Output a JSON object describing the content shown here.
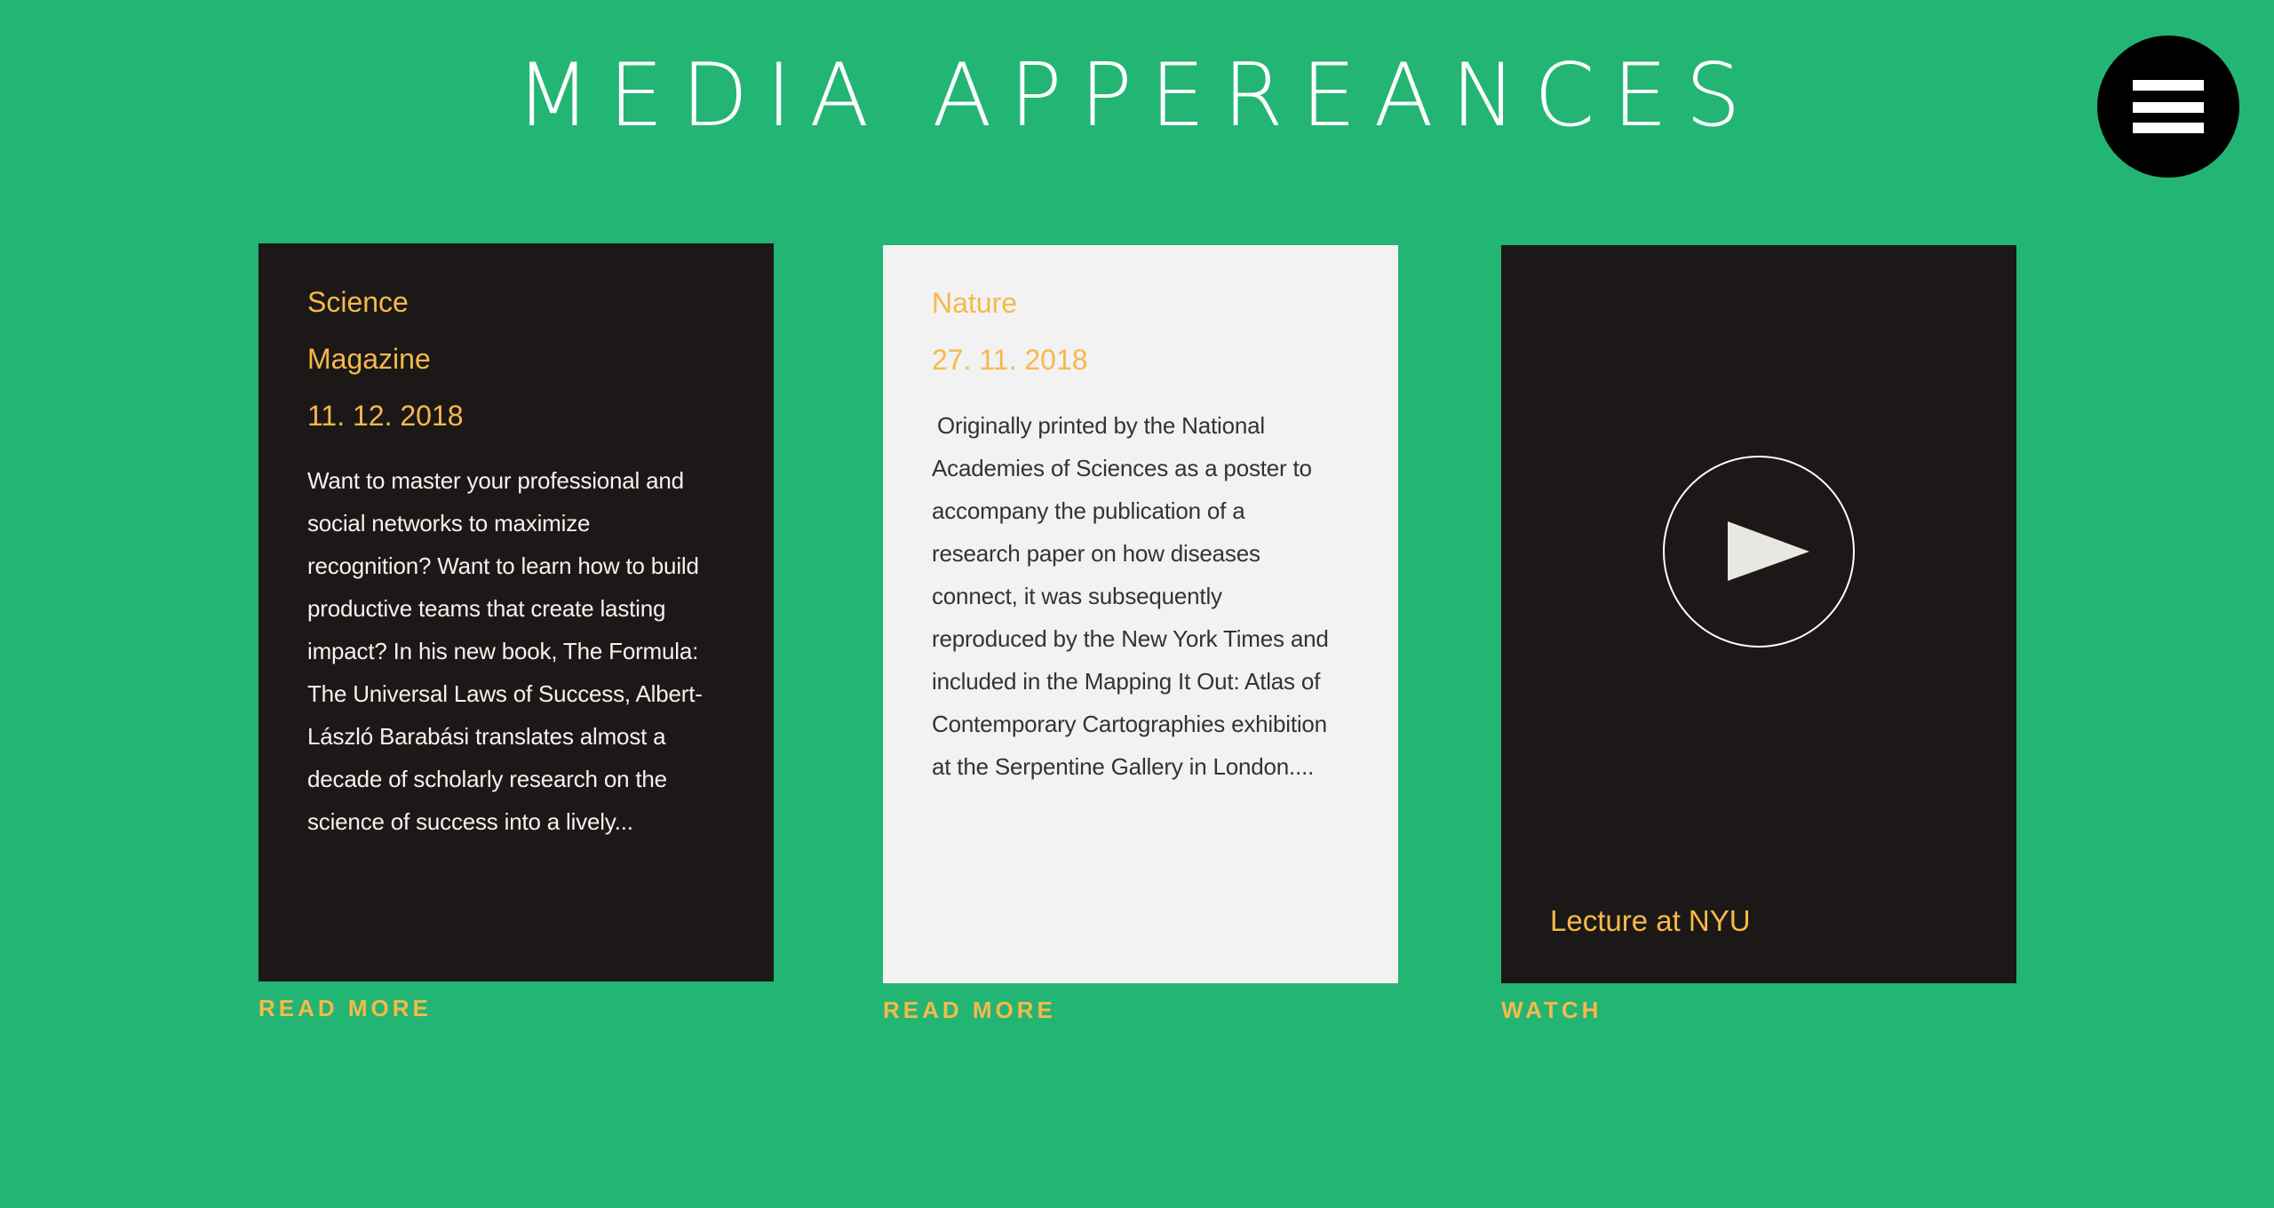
{
  "header": {
    "title": "MEDIA APPEREANCES",
    "menu_icon": "hamburger-icon"
  },
  "colors": {
    "background": "#23b574",
    "card_dark": "#1c1817",
    "card_light": "#f2f2f2",
    "accent": "#f6b94a"
  },
  "cards": [
    {
      "source_line1": "Science",
      "source_line2": "Magazine",
      "date": "11. 12. 2018",
      "excerpt": "Want to master your professional and social networks to maximize recognition? Want to learn how to build productive teams that create lasting impact? In his new book, The Formula: The Universal Laws of Success, Albert-László Barabási translates almost a decade of scholarly research on the science of success into a lively...",
      "link": "READ MORE"
    },
    {
      "source": "Nature",
      "date": "27. 11. 2018",
      "excerpt": "Originally printed by the National Academies of Sciences as a poster to accompany the publication of a research paper on how diseases connect, it was subsequently reproduced by the New York Times and included in the Mapping It Out: Atlas of Contemporary Cartographies exhibition at the Serpentine Gallery in London....",
      "link": "READ MORE"
    },
    {
      "caption": "Lecture at NYU",
      "icon": "play-icon",
      "link": "WATCH"
    }
  ]
}
